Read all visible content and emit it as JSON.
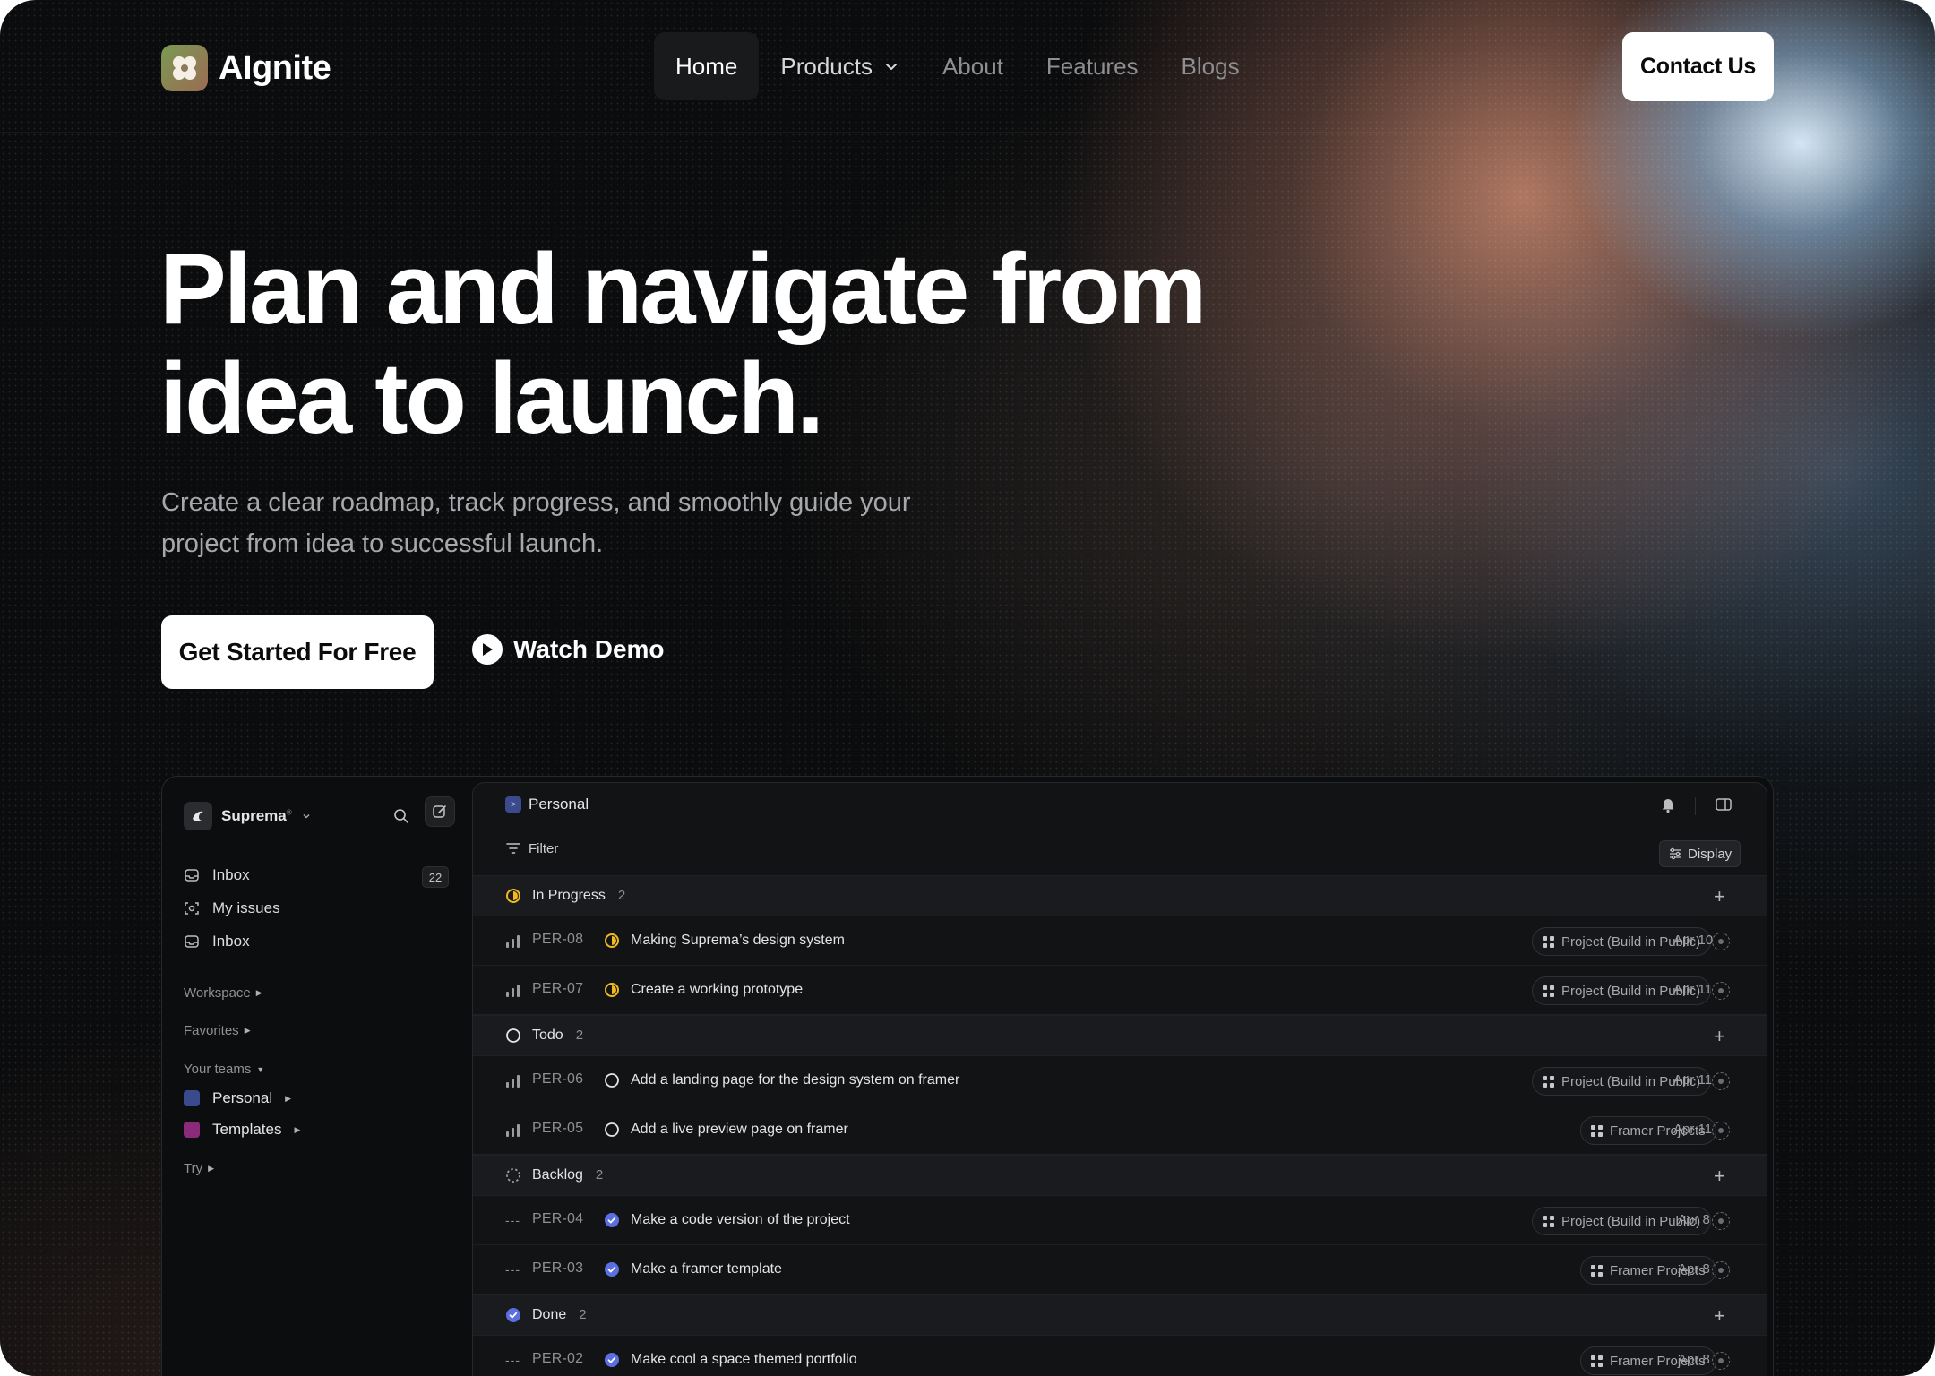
{
  "brand": {
    "name": "AIgnite"
  },
  "nav": {
    "items": [
      {
        "label": "Home"
      },
      {
        "label": "Products"
      },
      {
        "label": "About"
      },
      {
        "label": "Features"
      },
      {
        "label": "Blogs"
      }
    ],
    "contact_label": "Contact Us"
  },
  "hero": {
    "title_line1": "Plan and navigate from",
    "title_line2": "idea to launch.",
    "subtitle_line1": "Create a clear roadmap, track progress, and smoothly guide your",
    "subtitle_line2": "project from idea to successful launch.",
    "cta_label": "Get Started For Free",
    "demo_label": "Watch Demo"
  },
  "app": {
    "sidebar": {
      "workspace_name": "Suprema",
      "workspace_sup": "®",
      "items": [
        {
          "label": "Inbox",
          "icon": "inbox-icon"
        },
        {
          "label": "My issues",
          "icon": "target-icon"
        },
        {
          "label": "Inbox",
          "icon": "inbox-icon"
        }
      ],
      "inbox_count": "22",
      "sections": {
        "workspace": "Workspace",
        "favorites": "Favorites",
        "your_teams": "Your teams",
        "try": "Try"
      },
      "teams": [
        {
          "label": "Personal",
          "color": "#4a5fd0"
        },
        {
          "label": "Templates",
          "color": "#c43aa8"
        }
      ]
    },
    "main": {
      "title": "Personal",
      "filter_label": "Filter",
      "display_label": "Display",
      "groups": [
        {
          "name": "In Progress",
          "count": "2",
          "status": "in-progress",
          "rows": [
            {
              "id": "PER-08",
              "title": "Making Suprema’s design system",
              "tag": "Project (Build in Public)",
              "date": "Apr 10",
              "priority": "bars",
              "status": "in-progress"
            },
            {
              "id": "PER-07",
              "title": "Create a working prototype",
              "tag": "Project (Build in Public)",
              "date": "Apr 11",
              "priority": "bars",
              "status": "in-progress"
            }
          ]
        },
        {
          "name": "Todo",
          "count": "2",
          "status": "todo",
          "rows": [
            {
              "id": "PER-06",
              "title": "Add a landing page for the design system on framer",
              "tag": "Project (Build in Public)",
              "date": "Apr 11",
              "priority": "bars",
              "status": "todo"
            },
            {
              "id": "PER-05",
              "title": "Add a live preview page on framer",
              "tag": "Framer Projects",
              "date": "Apr 11",
              "priority": "bars",
              "status": "todo"
            }
          ]
        },
        {
          "name": "Backlog",
          "count": "2",
          "status": "backlog",
          "rows": [
            {
              "id": "PER-04",
              "title": "Make a code version of the project",
              "tag": "Project (Build in Public)",
              "date": "Apr 8",
              "priority": "dots",
              "status": "done"
            },
            {
              "id": "PER-03",
              "title": "Make a framer template",
              "tag": "Framer Projects",
              "date": "Apr 8",
              "priority": "dots",
              "status": "done"
            }
          ]
        },
        {
          "name": "Done",
          "count": "2",
          "status": "done",
          "rows": [
            {
              "id": "PER-02",
              "title": "Make cool a space themed portfolio",
              "tag": "Framer Projects",
              "date": "Apr 8",
              "priority": "dots",
              "status": "done"
            }
          ]
        }
      ]
    }
  },
  "colors": {
    "accent_yellow": "#f2b91e",
    "accent_blue": "#5b6fe0",
    "background": "#0b0c0d"
  }
}
